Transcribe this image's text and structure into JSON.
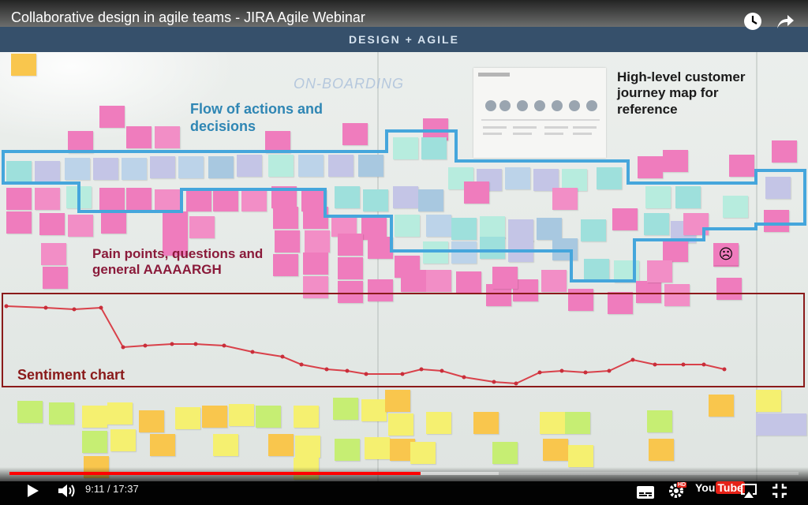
{
  "video": {
    "title": "Collaborative design in agile teams - JIRA Agile Webinar"
  },
  "frame": {
    "banner": "DESIGN + AGILE",
    "whiteboard_heading": "ON-BOARDING",
    "annotations": {
      "flow": [
        "Flow of actions and",
        "decisions"
      ],
      "journey": [
        "High-level customer",
        "journey map for",
        "reference"
      ],
      "pain": [
        "Pain points, questions and",
        "general AAAAARGH"
      ],
      "sentiment": "Sentiment chart"
    },
    "colors": {
      "flow_outline": "#45a6dc",
      "sentiment_outline": "#8b1a1a",
      "sentiment_line": "#d9414a",
      "banner_bg": "#36506b"
    }
  },
  "controls": {
    "current_time": "9:11",
    "duration": "17:37",
    "time_display": "9:11 / 17:37",
    "progress_played_fraction": 0.521,
    "progress_buffered_fraction": 0.62,
    "hd_label": "HD",
    "youtube_logo": {
      "you": "You",
      "tube": "Tube"
    },
    "icons": [
      "play-icon",
      "volume-icon",
      "subtitles-icon",
      "settings-icon",
      "airplay-icon",
      "fullscreen-exit-icon",
      "watch-later-icon",
      "share-icon"
    ]
  }
}
